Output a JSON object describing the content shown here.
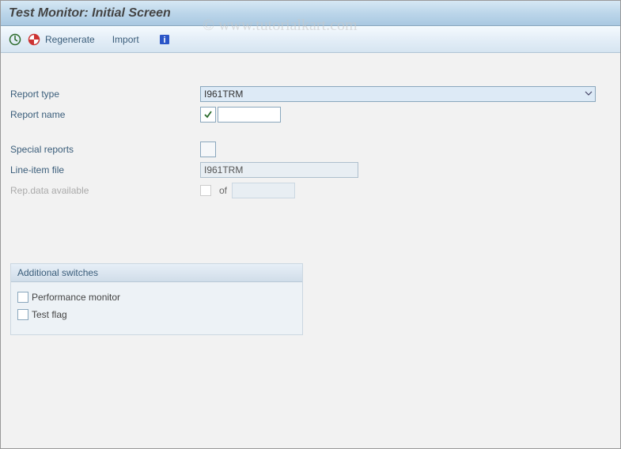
{
  "window": {
    "title": "Test Monitor: Initial Screen"
  },
  "toolbar": {
    "regenerate_label": "Regenerate",
    "import_label": "Import"
  },
  "watermark": "© www.tutorialkart.com",
  "form": {
    "report_type_label": "Report type",
    "report_type_value": "I961TRM",
    "report_name_label": "Report name",
    "report_name_value": "",
    "special_reports_label": "Special reports",
    "line_item_file_label": "Line-item file",
    "line_item_file_value": "I961TRM",
    "rep_data_label": "Rep.data available",
    "of_text": "of"
  },
  "panel": {
    "header": "Additional switches",
    "performance_label": "Performance monitor",
    "test_flag_label": "Test flag"
  }
}
